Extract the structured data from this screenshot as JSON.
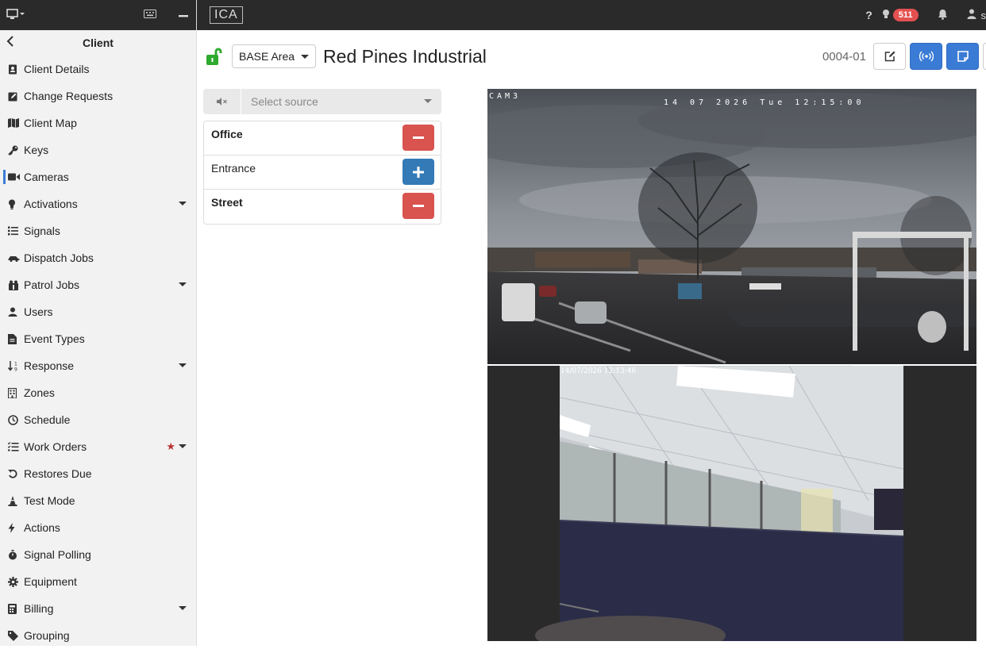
{
  "sidebar": {
    "title": "Client",
    "items": [
      {
        "label": "Client Details",
        "icon": "address-card-icon"
      },
      {
        "label": "Change Requests",
        "icon": "edit-icon"
      },
      {
        "label": "Client Map",
        "icon": "map-icon"
      },
      {
        "label": "Keys",
        "icon": "key-icon"
      },
      {
        "label": "Cameras",
        "icon": "video-icon",
        "active": true
      },
      {
        "label": "Activations",
        "icon": "lightbulb-icon",
        "caret": true
      },
      {
        "label": "Signals",
        "icon": "list-icon"
      },
      {
        "label": "Dispatch Jobs",
        "icon": "car-icon"
      },
      {
        "label": "Patrol Jobs",
        "icon": "patrol-icon",
        "caret": true
      },
      {
        "label": "Users",
        "icon": "user-icon"
      },
      {
        "label": "Event Types",
        "icon": "file-icon"
      },
      {
        "label": "Response",
        "icon": "sort-numeric-icon",
        "caret": true
      },
      {
        "label": "Zones",
        "icon": "building-icon"
      },
      {
        "label": "Schedule",
        "icon": "clock-icon"
      },
      {
        "label": "Work Orders",
        "icon": "tasks-icon",
        "caret": true,
        "star": true
      },
      {
        "label": "Restores Due",
        "icon": "undo-icon"
      },
      {
        "label": "Test Mode",
        "icon": "cone-icon"
      },
      {
        "label": "Actions",
        "icon": "bolt-icon"
      },
      {
        "label": "Signal Polling",
        "icon": "stopwatch-icon"
      },
      {
        "label": "Equipment",
        "icon": "cog-icon"
      },
      {
        "label": "Billing",
        "icon": "calculator-icon",
        "caret": true
      },
      {
        "label": "Grouping",
        "icon": "tag-icon"
      }
    ]
  },
  "topbar": {
    "logo": "ICA",
    "help": "?",
    "alert_count": "511",
    "user_initial": "s"
  },
  "header": {
    "area": "BASE Area",
    "client_name": "Red Pines Industrial",
    "account": "0004-01"
  },
  "source": {
    "placeholder": "Select source"
  },
  "cameras": [
    {
      "name": "Office",
      "action": "remove",
      "bold": true
    },
    {
      "name": "Entrance",
      "action": "add",
      "bold": false
    },
    {
      "name": "Street",
      "action": "remove",
      "bold": true
    }
  ],
  "feeds": {
    "street_label": "CAM3",
    "street_timestamp": "14 07 2026 Tue 12:15:00",
    "office_timestamp": "14/07/2026 12:13:46"
  },
  "colors": {
    "accent": "#3a7bd5",
    "danger": "#d9534f",
    "lock": "#2eaa2e"
  }
}
